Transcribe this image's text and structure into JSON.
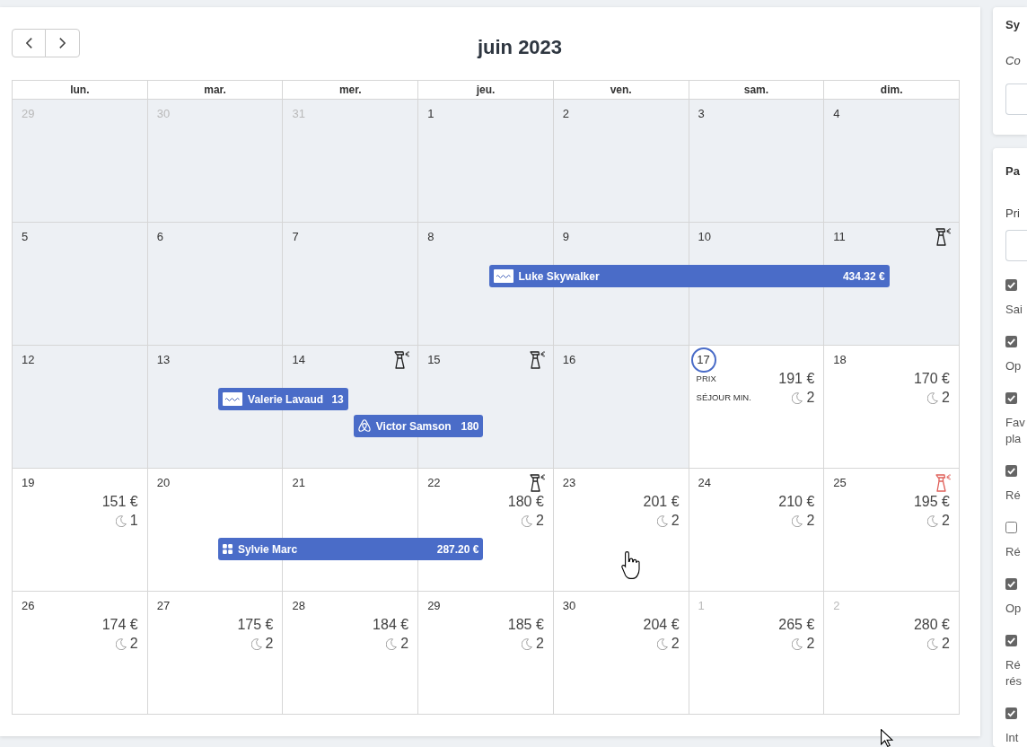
{
  "title": "juin 2023",
  "weekdays": [
    "lun.",
    "mar.",
    "mer.",
    "jeu.",
    "ven.",
    "sam.",
    "dim."
  ],
  "weeks": [
    {
      "days": [
        {
          "day": "29",
          "past": true,
          "other_month": true,
          "today": false
        },
        {
          "day": "30",
          "past": true,
          "other_month": true,
          "today": false
        },
        {
          "day": "31",
          "past": true,
          "other_month": true,
          "today": false
        },
        {
          "day": "1",
          "past": true,
          "other_month": false,
          "today": false
        },
        {
          "day": "2",
          "past": true,
          "other_month": false,
          "today": false
        },
        {
          "day": "3",
          "past": true,
          "other_month": false,
          "today": false
        },
        {
          "day": "4",
          "past": true,
          "other_month": false,
          "today": false
        }
      ]
    },
    {
      "days": [
        {
          "day": "5",
          "past": true,
          "other_month": false,
          "today": false
        },
        {
          "day": "6",
          "past": true,
          "other_month": false,
          "today": false
        },
        {
          "day": "7",
          "past": true,
          "other_month": false,
          "today": false
        },
        {
          "day": "8",
          "past": true,
          "other_month": false,
          "today": false,
          "booking": {
            "kind": "vrbo",
            "guest": "Luke Skywalker",
            "amount": "434.32 €"
          }
        },
        {
          "day": "9",
          "past": true,
          "other_month": false,
          "today": false
        },
        {
          "day": "10",
          "past": true,
          "other_month": false,
          "today": false
        },
        {
          "day": "11",
          "past": true,
          "other_month": false,
          "today": false,
          "check_out": true,
          "cleaning": {
            "kind": "normal"
          }
        }
      ]
    },
    {
      "days": [
        {
          "day": "12",
          "past": true,
          "other_month": false,
          "today": false
        },
        {
          "day": "13",
          "past": true,
          "other_month": false,
          "today": false,
          "booking": {
            "kind": "vrbo",
            "guest": "Valerie Lavaud",
            "amount": "13"
          }
        },
        {
          "day": "14",
          "past": true,
          "other_month": false,
          "today": false,
          "check_out": true,
          "cleaning": {
            "kind": "normal"
          },
          "booking": {
            "kind": "airbnb",
            "guest": "Victor Samson",
            "amount": "180"
          }
        },
        {
          "day": "15",
          "past": true,
          "other_month": false,
          "today": false,
          "check_out": true,
          "cleaning": {
            "kind": "normal"
          }
        },
        {
          "day": "16",
          "past": true,
          "other_month": false,
          "today": false
        },
        {
          "day": "17",
          "past": false,
          "other_month": false,
          "today": true,
          "price_label": "PRIX",
          "price": "191 €",
          "min_stay_label": "SÉJOUR MIN.",
          "min_stay": "2"
        },
        {
          "day": "18",
          "past": false,
          "other_month": false,
          "today": false,
          "price": "170 €",
          "min_stay": "2"
        }
      ]
    },
    {
      "days": [
        {
          "day": "19",
          "past": false,
          "other_month": false,
          "today": false,
          "price": "151 €",
          "min_stay": "1"
        },
        {
          "day": "20",
          "past": false,
          "other_month": false,
          "today": false,
          "booking": {
            "kind": "direct",
            "guest": "Sylvie Marc",
            "amount": "287.20 €"
          }
        },
        {
          "day": "21",
          "past": false,
          "other_month": false,
          "today": false
        },
        {
          "day": "22",
          "past": false,
          "other_month": false,
          "today": false,
          "check_out": true,
          "cleaning": {
            "kind": "normal"
          },
          "price": "180 €",
          "min_stay": "2"
        },
        {
          "day": "23",
          "past": false,
          "other_month": false,
          "today": false,
          "price": "201 €",
          "min_stay": "2"
        },
        {
          "day": "24",
          "past": false,
          "other_month": false,
          "today": false,
          "price": "210 €",
          "min_stay": "2"
        },
        {
          "day": "25",
          "past": false,
          "other_month": false,
          "today": false,
          "cleaning": {
            "kind": "alert"
          },
          "price": "195 €",
          "min_stay": "2"
        }
      ]
    },
    {
      "days": [
        {
          "day": "26",
          "past": false,
          "other_month": false,
          "today": false,
          "price": "174 €",
          "min_stay": "2"
        },
        {
          "day": "27",
          "past": false,
          "other_month": false,
          "today": false,
          "price": "175 €",
          "min_stay": "2"
        },
        {
          "day": "28",
          "past": false,
          "other_month": false,
          "today": false,
          "price": "184 €",
          "min_stay": "2"
        },
        {
          "day": "29",
          "past": false,
          "other_month": false,
          "today": false,
          "price": "185 €",
          "min_stay": "2"
        },
        {
          "day": "30",
          "past": false,
          "other_month": false,
          "today": false,
          "price": "204 €",
          "min_stay": "2"
        },
        {
          "day": "1",
          "past": false,
          "other_month": true,
          "today": false,
          "price": "265 €",
          "min_stay": "2"
        },
        {
          "day": "2",
          "past": false,
          "other_month": true,
          "today": false,
          "price": "280 €",
          "min_stay": "2"
        }
      ]
    }
  ],
  "side_panels": [
    {
      "title": "Sy",
      "items": [
        {
          "kind": "hint",
          "text": "Co"
        },
        {
          "kind": "input"
        }
      ]
    },
    {
      "title": "Pa",
      "items": [
        {
          "kind": "label",
          "text": "Pri"
        },
        {
          "kind": "input"
        },
        {
          "kind": "checkbox",
          "checked": true
        },
        {
          "kind": "note",
          "lines": [
            "Sai"
          ]
        },
        {
          "kind": "checkbox",
          "checked": true
        },
        {
          "kind": "note",
          "lines": [
            "Op"
          ]
        },
        {
          "kind": "checkbox",
          "checked": true
        },
        {
          "kind": "note",
          "lines": [
            "Fav",
            "pla"
          ]
        },
        {
          "kind": "checkbox",
          "checked": true
        },
        {
          "kind": "note",
          "lines": [
            "Ré"
          ]
        },
        {
          "kind": "checkbox",
          "checked": false
        },
        {
          "kind": "note",
          "lines": [
            "Ré"
          ]
        },
        {
          "kind": "checkbox",
          "checked": true
        },
        {
          "kind": "note",
          "lines": [
            "Op"
          ]
        },
        {
          "kind": "checkbox",
          "checked": true
        },
        {
          "kind": "note",
          "lines": [
            "Ré",
            "rés"
          ]
        },
        {
          "kind": "checkbox",
          "checked": true
        },
        {
          "kind": "note",
          "lines": [
            "Int"
          ]
        }
      ]
    }
  ]
}
